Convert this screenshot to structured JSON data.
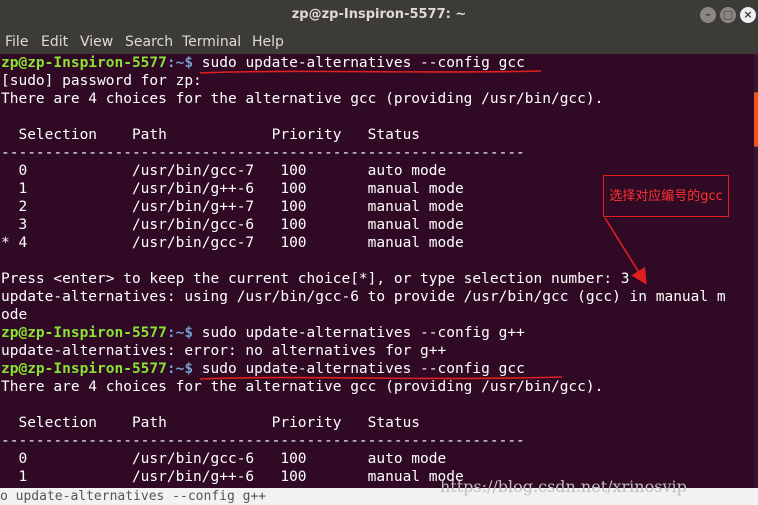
{
  "window": {
    "title": "zp@zp-Inspiron-5577: ~",
    "buttons": {
      "minimize": "–",
      "maximize": "□",
      "close": "×"
    }
  },
  "menu": {
    "items": [
      "File",
      "Edit",
      "View",
      "Search",
      "Terminal",
      "Help"
    ]
  },
  "terminal": {
    "prompt_user": "zp@zp-Inspiron-5577",
    "prompt_path": ":~$ ",
    "lines": [
      {
        "type": "prompt",
        "cmd": "sudo update-alternatives --config gcc"
      },
      {
        "type": "text",
        "text": "[sudo] password for zp:"
      },
      {
        "type": "text",
        "text": "There are 4 choices for the alternative gcc (providing /usr/bin/gcc)."
      },
      {
        "type": "text",
        "text": ""
      },
      {
        "type": "text",
        "text": "  Selection    Path            Priority   Status"
      },
      {
        "type": "text",
        "text": "------------------------------------------------------------"
      },
      {
        "type": "text",
        "text": "  0            /usr/bin/gcc-7   100       auto mode"
      },
      {
        "type": "text",
        "text": "  1            /usr/bin/g++-6   100       manual mode"
      },
      {
        "type": "text",
        "text": "  2            /usr/bin/g++-7   100       manual mode"
      },
      {
        "type": "text",
        "text": "  3            /usr/bin/gcc-6   100       manual mode"
      },
      {
        "type": "text",
        "text": "* 4            /usr/bin/gcc-7   100       manual mode"
      },
      {
        "type": "text",
        "text": ""
      },
      {
        "type": "text",
        "text": "Press <enter> to keep the current choice[*], or type selection number: 3"
      },
      {
        "type": "text",
        "text": "update-alternatives: using /usr/bin/gcc-6 to provide /usr/bin/gcc (gcc) in manual m"
      },
      {
        "type": "text",
        "text": "ode"
      },
      {
        "type": "prompt",
        "cmd": "sudo update-alternatives --config g++"
      },
      {
        "type": "text",
        "text": "update-alternatives: error: no alternatives for g++"
      },
      {
        "type": "prompt",
        "cmd": "sudo update-alternatives --config gcc"
      },
      {
        "type": "text",
        "text": "There are 4 choices for the alternative gcc (providing /usr/bin/gcc)."
      },
      {
        "type": "text",
        "text": ""
      },
      {
        "type": "text",
        "text": "  Selection    Path            Priority   Status"
      },
      {
        "type": "text",
        "text": "------------------------------------------------------------"
      },
      {
        "type": "text",
        "text": "  0            /usr/bin/gcc-6   100       auto mode"
      },
      {
        "type": "text",
        "text": "  1            /usr/bin/g++-6   100       manual mode"
      }
    ],
    "status_line": "o update-alternatives --config g++"
  },
  "annotation": {
    "label": "选择对应编号的gcc",
    "color": "#e02020"
  },
  "watermark": "https://blog.csdn.net/xrinosvip",
  "colors": {
    "background": "#300a24",
    "prompt_user": "#8ae234",
    "prompt_path": "#729fcf",
    "accent": "#e95420"
  }
}
